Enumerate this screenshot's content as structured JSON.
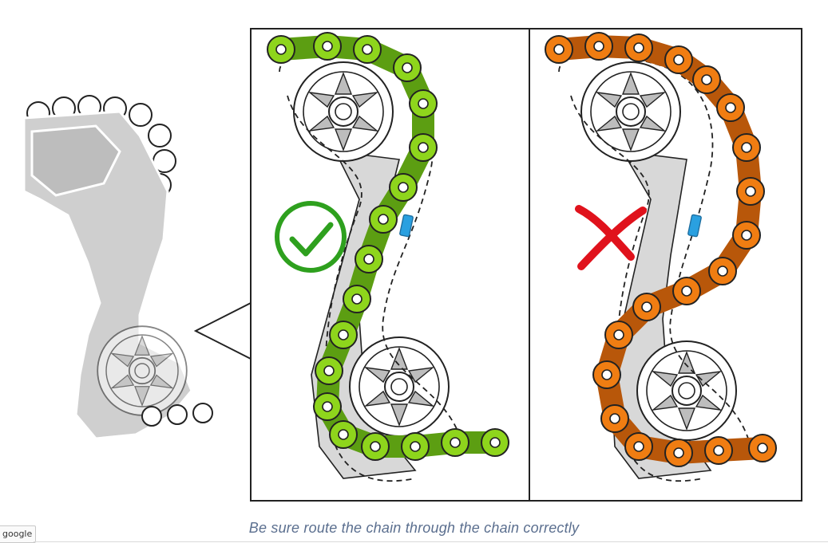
{
  "caption": "Be sure route the chain through the chain correctly",
  "badge": "google",
  "colors": {
    "correct_chain": "#8ed51c",
    "wrong_chain": "#f07d12",
    "check_mark": "#2ea01e",
    "cross_mark": "#e0121c",
    "cage_gray": "#cfcfcf",
    "limit_tab": "#2aa0e0"
  },
  "icons": [
    "check-icon",
    "cross-icon"
  ]
}
